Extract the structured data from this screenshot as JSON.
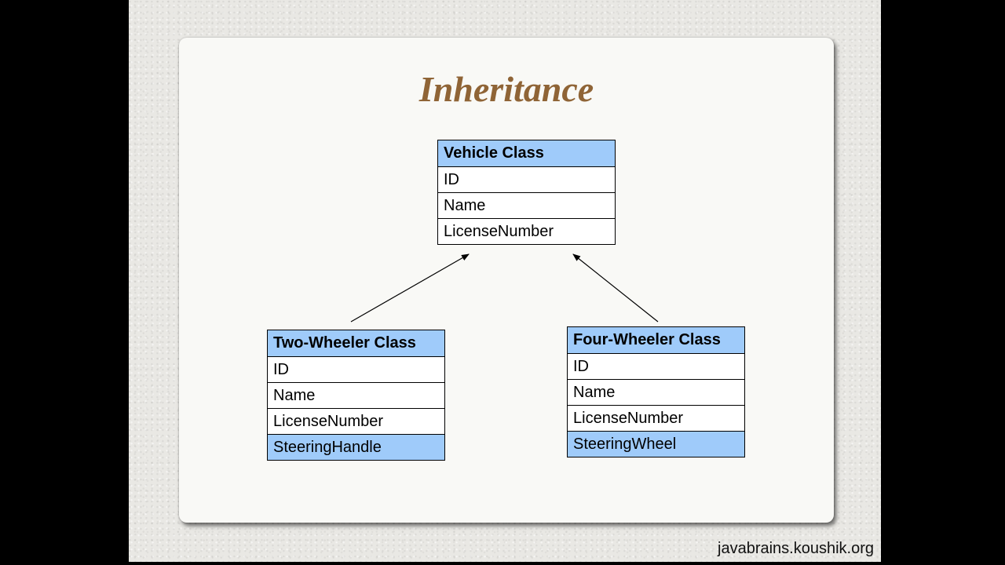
{
  "slide": {
    "title": "Inheritance",
    "footer": "javabrains.koushik.org"
  },
  "classes": {
    "vehicle": {
      "name": "Vehicle Class",
      "fields": [
        "ID",
        "Name",
        "LicenseNumber"
      ]
    },
    "two_wheeler": {
      "name": "Two-Wheeler Class",
      "fields": [
        "ID",
        "Name",
        "LicenseNumber",
        "SteeringHandle"
      ],
      "extra_field": "SteeringHandle"
    },
    "four_wheeler": {
      "name": "Four-Wheeler Class",
      "fields": [
        "ID",
        "Name",
        "LicenseNumber",
        "SteeringWheel"
      ],
      "extra_field": "SteeringWheel"
    }
  },
  "colors": {
    "header_fill": "#9fcbfa",
    "title": "#8f6436"
  }
}
